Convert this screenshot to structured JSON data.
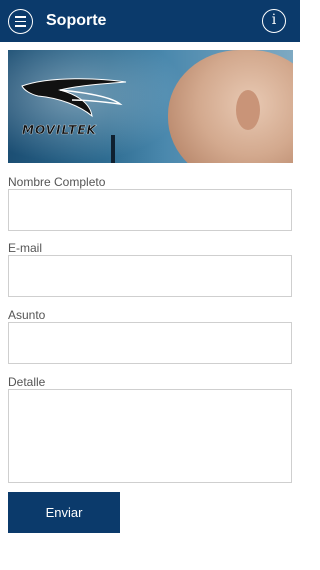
{
  "appbar": {
    "title": "Soporte",
    "menu_icon": "menu-icon",
    "info_icon": "info-icon",
    "info_glyph": "i",
    "color": "#0b3a6b"
  },
  "banner": {
    "logo_text": "MOVILTEK"
  },
  "form": {
    "fields": [
      {
        "label": "Nombre Completo",
        "value": "",
        "placeholder": ""
      },
      {
        "label": "E-mail",
        "value": "",
        "placeholder": ""
      },
      {
        "label": "Asunto",
        "value": "",
        "placeholder": ""
      },
      {
        "label": "Detalle",
        "value": "",
        "placeholder": ""
      }
    ],
    "submit_label": "Enviar"
  }
}
